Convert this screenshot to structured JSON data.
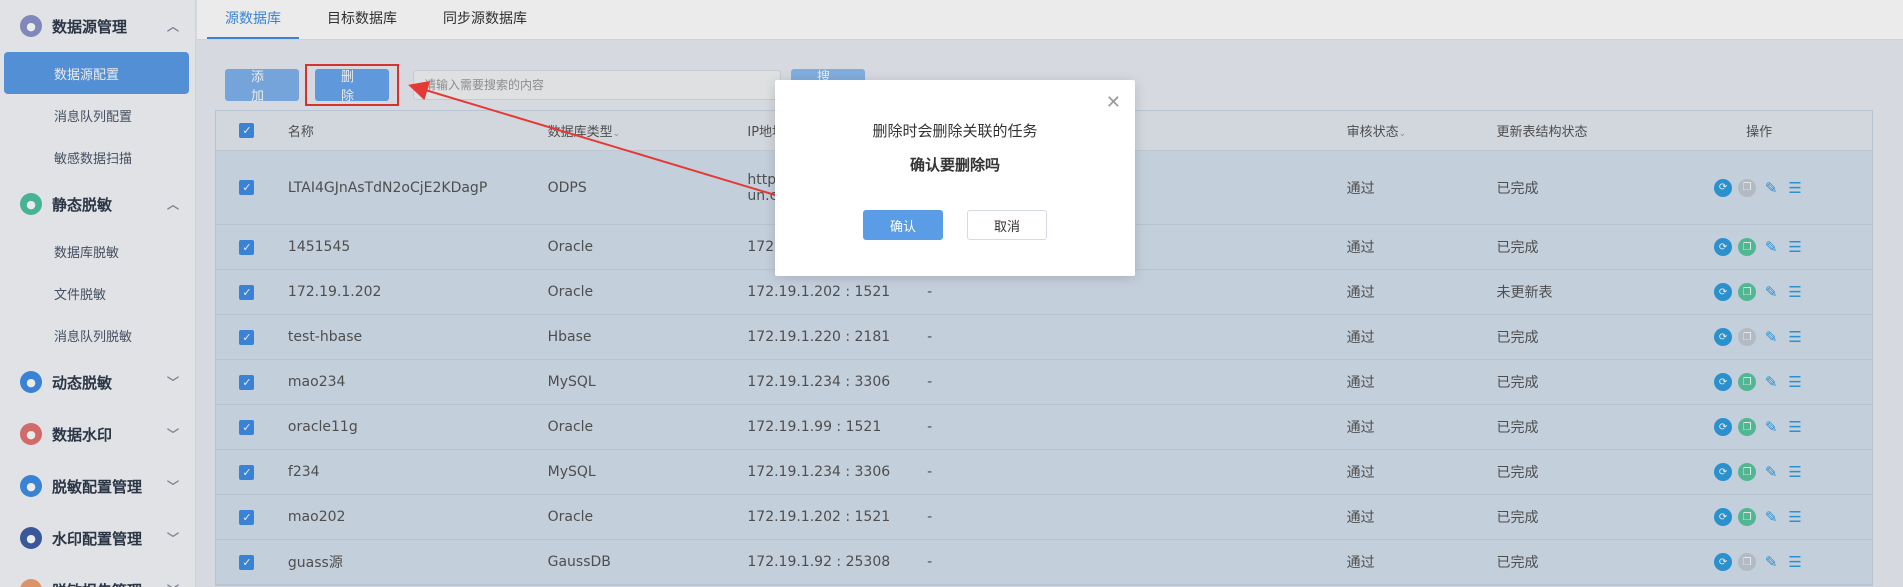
{
  "sidebar": {
    "groups": [
      {
        "label": "数据源管理",
        "icon": "database-icon",
        "color": "#8b93c9",
        "expanded": true,
        "items": [
          {
            "label": "数据源配置",
            "active": true
          },
          {
            "label": "消息队列配置"
          },
          {
            "label": "敏感数据扫描"
          }
        ]
      },
      {
        "label": "静态脱敏",
        "icon": "lock-icon",
        "color": "#4fc3a1",
        "expanded": true,
        "items": [
          {
            "label": "数据库脱敏"
          },
          {
            "label": "文件脱敏"
          },
          {
            "label": "消息队列脱敏"
          }
        ]
      },
      {
        "label": "动态脱敏",
        "icon": "dynamic-icon",
        "color": "#3f8ee8",
        "expanded": false
      },
      {
        "label": "数据水印",
        "icon": "watermark-icon",
        "color": "#e57373",
        "expanded": false
      },
      {
        "label": "脱敏配置管理",
        "icon": "gear-icon",
        "color": "#3f8ee8",
        "expanded": false
      },
      {
        "label": "水印配置管理",
        "icon": "watermark-config-icon",
        "color": "#3f5fa8",
        "expanded": false
      },
      {
        "label": "脱敏报告管理",
        "icon": "report-icon",
        "color": "#f0a070",
        "expanded": false
      }
    ]
  },
  "tabs": [
    {
      "label": "源数据库",
      "active": true
    },
    {
      "label": "目标数据库"
    },
    {
      "label": "同步源数据库"
    }
  ],
  "toolbar": {
    "add_label": "添加",
    "delete_label": "删除",
    "search_placeholder": "请输入需要搜索的内容",
    "search_label": "搜索"
  },
  "table": {
    "headers": {
      "name": "名称",
      "type": "数据库类型",
      "ip": "IP地址",
      "audit": "审核状态",
      "update": "更新表结构状态",
      "ops": "操作"
    },
    "rows": [
      {
        "name": "LTAI4GJnAsTdN2oCjE2KDagP",
        "type": "ODPS",
        "ip": "http",
        "ip2": "un.c",
        "desc": "",
        "audit": "通过",
        "update": "已完成",
        "copy_disabled": true
      },
      {
        "name": "1451545",
        "type": "Oracle",
        "ip": "172",
        "desc": "",
        "audit": "通过",
        "update": "已完成",
        "copy_disabled": false
      },
      {
        "name": "172.19.1.202",
        "type": "Oracle",
        "ip": "172.19.1.202 : 1521",
        "desc": "-",
        "audit": "通过",
        "update": "未更新表",
        "copy_disabled": false
      },
      {
        "name": "test-hbase",
        "type": "Hbase",
        "ip": "172.19.1.220 : 2181",
        "desc": "-",
        "audit": "通过",
        "update": "已完成",
        "copy_disabled": true
      },
      {
        "name": "mao234",
        "type": "MySQL",
        "ip": "172.19.1.234 : 3306",
        "desc": "-",
        "audit": "通过",
        "update": "已完成",
        "copy_disabled": false
      },
      {
        "name": "oracle11g",
        "type": "Oracle",
        "ip": "172.19.1.99 : 1521",
        "desc": "-",
        "audit": "通过",
        "update": "已完成",
        "copy_disabled": false
      },
      {
        "name": "f234",
        "type": "MySQL",
        "ip": "172.19.1.234 : 3306",
        "desc": "-",
        "audit": "通过",
        "update": "已完成",
        "copy_disabled": false
      },
      {
        "name": "mao202",
        "type": "Oracle",
        "ip": "172.19.1.202 : 1521",
        "desc": "-",
        "audit": "通过",
        "update": "已完成",
        "copy_disabled": false
      },
      {
        "name": "guass源",
        "type": "GaussDB",
        "ip": "172.19.1.92 : 25308",
        "desc": "-",
        "audit": "通过",
        "update": "已完成",
        "copy_disabled": true
      }
    ]
  },
  "dialog": {
    "message": "删除时会删除关联的任务",
    "confirm_question": "确认要删除吗",
    "ok_label": "确认",
    "cancel_label": "取消"
  }
}
